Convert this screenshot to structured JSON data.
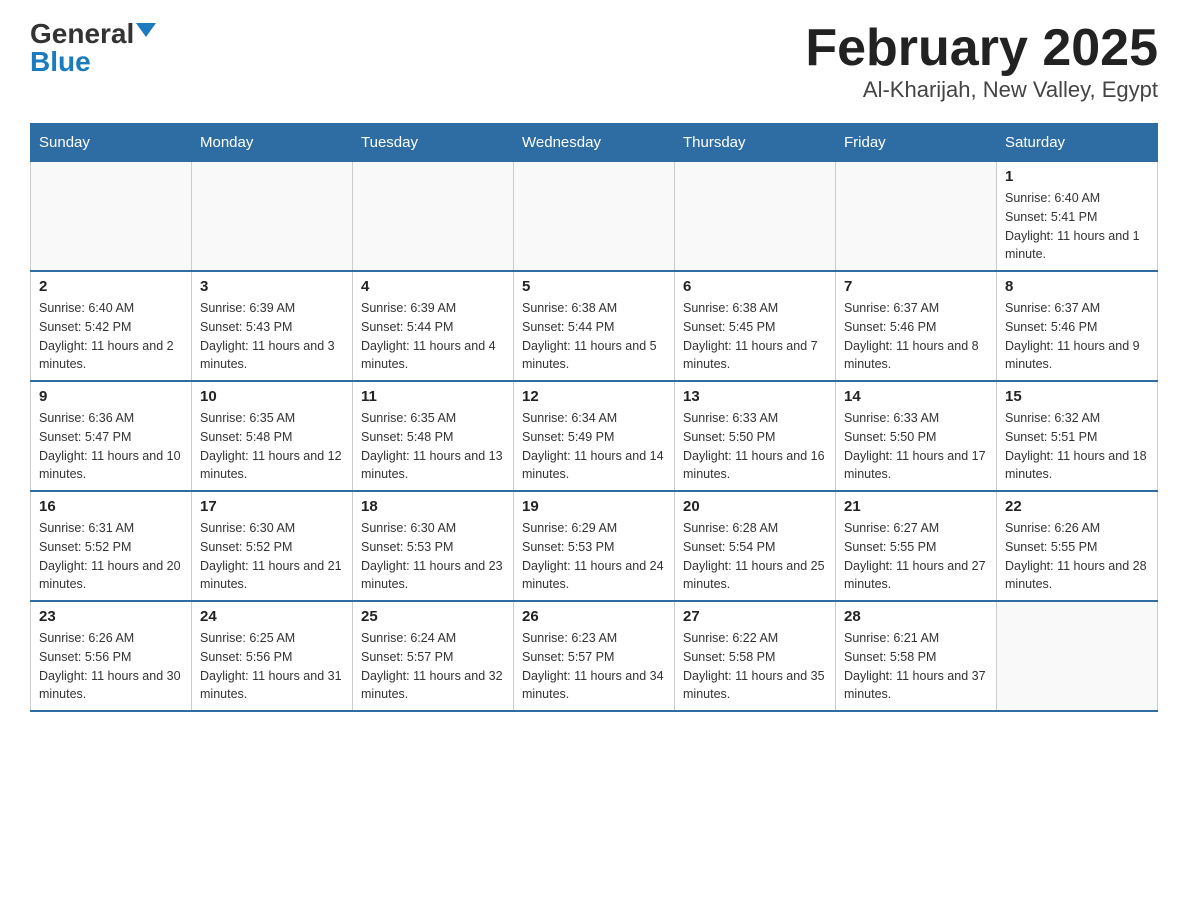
{
  "logo": {
    "text_general": "General",
    "text_blue": "Blue"
  },
  "title": "February 2025",
  "subtitle": "Al-Kharijah, New Valley, Egypt",
  "days_of_week": [
    "Sunday",
    "Monday",
    "Tuesday",
    "Wednesday",
    "Thursday",
    "Friday",
    "Saturday"
  ],
  "weeks": [
    [
      {
        "day": null
      },
      {
        "day": null
      },
      {
        "day": null
      },
      {
        "day": null
      },
      {
        "day": null
      },
      {
        "day": null
      },
      {
        "day": 1,
        "sunrise": "Sunrise: 6:40 AM",
        "sunset": "Sunset: 5:41 PM",
        "daylight": "Daylight: 11 hours and 1 minute."
      }
    ],
    [
      {
        "day": 2,
        "sunrise": "Sunrise: 6:40 AM",
        "sunset": "Sunset: 5:42 PM",
        "daylight": "Daylight: 11 hours and 2 minutes."
      },
      {
        "day": 3,
        "sunrise": "Sunrise: 6:39 AM",
        "sunset": "Sunset: 5:43 PM",
        "daylight": "Daylight: 11 hours and 3 minutes."
      },
      {
        "day": 4,
        "sunrise": "Sunrise: 6:39 AM",
        "sunset": "Sunset: 5:44 PM",
        "daylight": "Daylight: 11 hours and 4 minutes."
      },
      {
        "day": 5,
        "sunrise": "Sunrise: 6:38 AM",
        "sunset": "Sunset: 5:44 PM",
        "daylight": "Daylight: 11 hours and 5 minutes."
      },
      {
        "day": 6,
        "sunrise": "Sunrise: 6:38 AM",
        "sunset": "Sunset: 5:45 PM",
        "daylight": "Daylight: 11 hours and 7 minutes."
      },
      {
        "day": 7,
        "sunrise": "Sunrise: 6:37 AM",
        "sunset": "Sunset: 5:46 PM",
        "daylight": "Daylight: 11 hours and 8 minutes."
      },
      {
        "day": 8,
        "sunrise": "Sunrise: 6:37 AM",
        "sunset": "Sunset: 5:46 PM",
        "daylight": "Daylight: 11 hours and 9 minutes."
      }
    ],
    [
      {
        "day": 9,
        "sunrise": "Sunrise: 6:36 AM",
        "sunset": "Sunset: 5:47 PM",
        "daylight": "Daylight: 11 hours and 10 minutes."
      },
      {
        "day": 10,
        "sunrise": "Sunrise: 6:35 AM",
        "sunset": "Sunset: 5:48 PM",
        "daylight": "Daylight: 11 hours and 12 minutes."
      },
      {
        "day": 11,
        "sunrise": "Sunrise: 6:35 AM",
        "sunset": "Sunset: 5:48 PM",
        "daylight": "Daylight: 11 hours and 13 minutes."
      },
      {
        "day": 12,
        "sunrise": "Sunrise: 6:34 AM",
        "sunset": "Sunset: 5:49 PM",
        "daylight": "Daylight: 11 hours and 14 minutes."
      },
      {
        "day": 13,
        "sunrise": "Sunrise: 6:33 AM",
        "sunset": "Sunset: 5:50 PM",
        "daylight": "Daylight: 11 hours and 16 minutes."
      },
      {
        "day": 14,
        "sunrise": "Sunrise: 6:33 AM",
        "sunset": "Sunset: 5:50 PM",
        "daylight": "Daylight: 11 hours and 17 minutes."
      },
      {
        "day": 15,
        "sunrise": "Sunrise: 6:32 AM",
        "sunset": "Sunset: 5:51 PM",
        "daylight": "Daylight: 11 hours and 18 minutes."
      }
    ],
    [
      {
        "day": 16,
        "sunrise": "Sunrise: 6:31 AM",
        "sunset": "Sunset: 5:52 PM",
        "daylight": "Daylight: 11 hours and 20 minutes."
      },
      {
        "day": 17,
        "sunrise": "Sunrise: 6:30 AM",
        "sunset": "Sunset: 5:52 PM",
        "daylight": "Daylight: 11 hours and 21 minutes."
      },
      {
        "day": 18,
        "sunrise": "Sunrise: 6:30 AM",
        "sunset": "Sunset: 5:53 PM",
        "daylight": "Daylight: 11 hours and 23 minutes."
      },
      {
        "day": 19,
        "sunrise": "Sunrise: 6:29 AM",
        "sunset": "Sunset: 5:53 PM",
        "daylight": "Daylight: 11 hours and 24 minutes."
      },
      {
        "day": 20,
        "sunrise": "Sunrise: 6:28 AM",
        "sunset": "Sunset: 5:54 PM",
        "daylight": "Daylight: 11 hours and 25 minutes."
      },
      {
        "day": 21,
        "sunrise": "Sunrise: 6:27 AM",
        "sunset": "Sunset: 5:55 PM",
        "daylight": "Daylight: 11 hours and 27 minutes."
      },
      {
        "day": 22,
        "sunrise": "Sunrise: 6:26 AM",
        "sunset": "Sunset: 5:55 PM",
        "daylight": "Daylight: 11 hours and 28 minutes."
      }
    ],
    [
      {
        "day": 23,
        "sunrise": "Sunrise: 6:26 AM",
        "sunset": "Sunset: 5:56 PM",
        "daylight": "Daylight: 11 hours and 30 minutes."
      },
      {
        "day": 24,
        "sunrise": "Sunrise: 6:25 AM",
        "sunset": "Sunset: 5:56 PM",
        "daylight": "Daylight: 11 hours and 31 minutes."
      },
      {
        "day": 25,
        "sunrise": "Sunrise: 6:24 AM",
        "sunset": "Sunset: 5:57 PM",
        "daylight": "Daylight: 11 hours and 32 minutes."
      },
      {
        "day": 26,
        "sunrise": "Sunrise: 6:23 AM",
        "sunset": "Sunset: 5:57 PM",
        "daylight": "Daylight: 11 hours and 34 minutes."
      },
      {
        "day": 27,
        "sunrise": "Sunrise: 6:22 AM",
        "sunset": "Sunset: 5:58 PM",
        "daylight": "Daylight: 11 hours and 35 minutes."
      },
      {
        "day": 28,
        "sunrise": "Sunrise: 6:21 AM",
        "sunset": "Sunset: 5:58 PM",
        "daylight": "Daylight: 11 hours and 37 minutes."
      },
      {
        "day": null
      }
    ]
  ]
}
